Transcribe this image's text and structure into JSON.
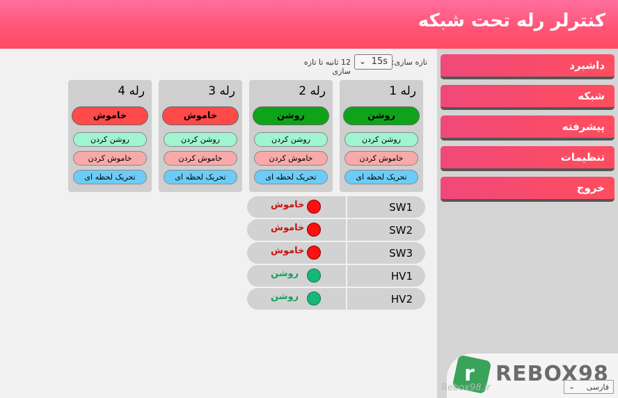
{
  "header": {
    "title": "کنترلر رله تحت شبکه"
  },
  "sidebar": {
    "items": [
      {
        "label": "داشبرد"
      },
      {
        "label": "شبکه"
      },
      {
        "label": "پیشرفته"
      },
      {
        "label": "تنظیمات"
      },
      {
        "label": "خروج"
      }
    ]
  },
  "refresh": {
    "label": "تازه سازی:",
    "selected": "15s",
    "countdown": "12",
    "countdown_suffix": "ثانیه تا تازه سازی"
  },
  "relays": [
    {
      "name": "رله 1",
      "state": "روشن",
      "state_kind": "on",
      "on_label": "روشن کردن",
      "off_label": "خاموش کردن",
      "pulse_label": "تحریک لحظه ای"
    },
    {
      "name": "رله 2",
      "state": "روشن",
      "state_kind": "on",
      "on_label": "روشن کردن",
      "off_label": "خاموش کردن",
      "pulse_label": "تحریک لحظه ای"
    },
    {
      "name": "رله 3",
      "state": "خاموش",
      "state_kind": "off",
      "on_label": "روشن کردن",
      "off_label": "خاموش کردن",
      "pulse_label": "تحریک لحظه ای"
    },
    {
      "name": "رله 4",
      "state": "خاموش",
      "state_kind": "off",
      "on_label": "روشن کردن",
      "off_label": "خاموش کردن",
      "pulse_label": "تحریک لحظه ای"
    }
  ],
  "inputs": [
    {
      "name": "SW1",
      "status": "خاموش",
      "status_kind": "off"
    },
    {
      "name": "SW2",
      "status": "خاموش",
      "status_kind": "off"
    },
    {
      "name": "SW3",
      "status": "خاموش",
      "status_kind": "off"
    },
    {
      "name": "HV1",
      "status": "روشن",
      "status_kind": "on"
    },
    {
      "name": "HV2",
      "status": "روشن",
      "status_kind": "on"
    }
  ],
  "watermark": {
    "brand": "REBOX98",
    "site": "Rebox98.ir"
  },
  "language": {
    "selected": "فارسی"
  },
  "colors": {
    "header": "#ff5577",
    "on": "#0fa31a",
    "off": "#ff4a4a",
    "status_on": "#17b877",
    "status_off": "#ff1010"
  }
}
